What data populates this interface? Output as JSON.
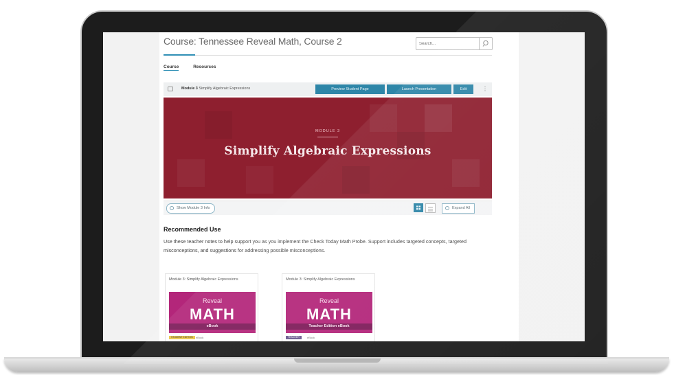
{
  "course": {
    "title": "Course: Tennessee Reveal Math, Course 2",
    "search_placeholder": "Search..."
  },
  "tabs": [
    {
      "label": "Course",
      "active": true
    },
    {
      "label": "Resources",
      "active": false
    }
  ],
  "module_bar": {
    "label_bold": "Module 3",
    "label": "Simplify Algebraic Expressions",
    "buttons": [
      "Preview Student Page",
      "Launch Presentation",
      "Edit"
    ],
    "more": "⋮"
  },
  "banner": {
    "kicker": "MODULE 3",
    "title": "Simplify Algebraic Expressions",
    "color": "#8e1f2f"
  },
  "controls": {
    "show_button": "Show Module 3 Info",
    "expand_button": "Expand All"
  },
  "recommended": {
    "heading": "Recommended Use",
    "text": "Use these teacher notes to help support you as you implement the Check Today Math Probe. Support includes targeted concepts, targeted misconceptions, and suggestions for addressing possible misconceptions."
  },
  "cards": [
    {
      "title": "Module 3: Simplify Algebraic Expressions",
      "cover_top": "Reveal",
      "cover_main": "MATH",
      "cover_sub": "eBook",
      "badge": "STUDENT EDITION",
      "badge_sub": "eBook"
    },
    {
      "title": "Module 3: Simplify Algebraic Expressions",
      "cover_top": "Reveal",
      "cover_main": "MATH",
      "cover_sub": "Teacher Edition eBook",
      "badge": "TEACHER",
      "badge_sub": "eBook"
    }
  ],
  "colors": {
    "accent": "#2e86a8",
    "cover": "#b3267a"
  }
}
